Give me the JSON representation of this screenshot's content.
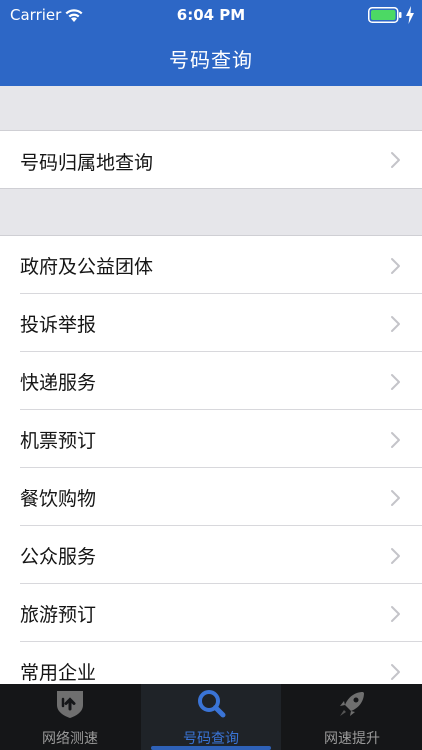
{
  "status_bar": {
    "carrier": "Carrier",
    "time": "6:04 PM",
    "battery_color": "#4cd964"
  },
  "nav": {
    "title": "号码查询",
    "bar_color": "#2d67c6"
  },
  "sections": [
    {
      "items": [
        {
          "label": "号码归属地查询",
          "icon": "chevron-right-icon"
        }
      ]
    },
    {
      "items": [
        {
          "label": "政府及公益团体",
          "icon": "chevron-right-icon"
        },
        {
          "label": "投诉举报",
          "icon": "chevron-right-icon"
        },
        {
          "label": "快递服务",
          "icon": "chevron-right-icon"
        },
        {
          "label": "机票预订",
          "icon": "chevron-right-icon"
        },
        {
          "label": "餐饮购物",
          "icon": "chevron-right-icon"
        },
        {
          "label": "公众服务",
          "icon": "chevron-right-icon"
        },
        {
          "label": "旅游预订",
          "icon": "chevron-right-icon"
        },
        {
          "label": "常用企业",
          "icon": "chevron-right-icon"
        }
      ]
    }
  ],
  "tabbar": {
    "tabs": [
      {
        "label": "网络测速",
        "icon": "speed-shield-icon",
        "active": false
      },
      {
        "label": "号码查询",
        "icon": "search-icon",
        "active": true
      },
      {
        "label": "网速提升",
        "icon": "rocket-icon",
        "active": false
      }
    ],
    "active_color": "#3a74d6"
  }
}
